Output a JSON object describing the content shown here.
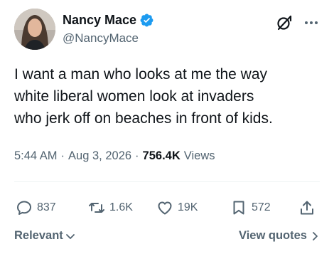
{
  "author": {
    "display_name": "Nancy Mace",
    "handle": "@NancyMace",
    "verified": true,
    "verified_color": "#1d9bf0"
  },
  "tweet": {
    "text": "I want a man who looks at me the way\nwhite liberal women look at invaders\nwho jerk off on beaches in front of kids."
  },
  "meta": {
    "time": "5:44 AM",
    "separator": "·",
    "date": "Aug 3, 2026",
    "views_count": "756.4K",
    "views_label": "Views"
  },
  "actions": {
    "replies": "837",
    "reposts": "1.6K",
    "likes": "19K",
    "bookmarks": "572"
  },
  "footer": {
    "sort_label": "Relevant",
    "view_quotes_label": "View quotes"
  },
  "colors": {
    "text_primary": "#0f1419",
    "text_secondary": "#536471",
    "divider": "#eff3f4"
  },
  "icons": {
    "grok": "grok-icon",
    "more": "more-icon",
    "reply": "reply-icon",
    "repost": "repost-icon",
    "like": "heart-icon",
    "bookmark": "bookmark-icon",
    "share": "share-icon"
  }
}
